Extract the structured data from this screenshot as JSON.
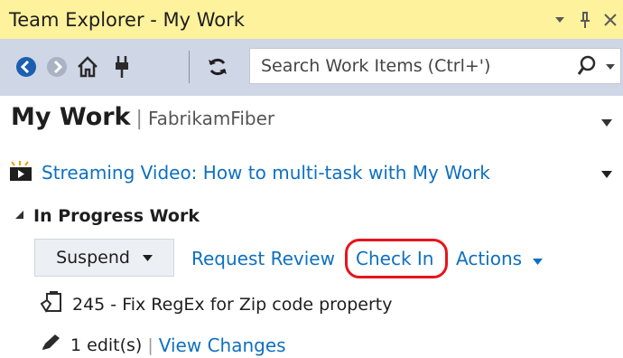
{
  "window": {
    "title": "Team Explorer - My Work"
  },
  "toolbar": {
    "search_placeholder": "Search Work Items (Ctrl+')"
  },
  "header": {
    "title": "My Work",
    "separator": "|",
    "project": "FabrikamFiber"
  },
  "video": {
    "link_label": "Streaming Video: How to multi-task with My Work"
  },
  "section": {
    "label": "In Progress Work",
    "suspend_label": "Suspend",
    "request_review_label": "Request Review",
    "check_in_label": "Check In",
    "actions_label": "Actions"
  },
  "work_item": {
    "label": "245 - Fix RegEx for Zip code property"
  },
  "changes": {
    "edits_label": "1 edit(s)",
    "separator": "|",
    "view_changes_label": "View Changes"
  },
  "colors": {
    "title_bar": "#fff29d",
    "toolbar": "#cfd6e5",
    "link": "#0e70c0",
    "highlight_ring": "#e8141b"
  },
  "icons": [
    "back-icon",
    "forward-icon",
    "home-icon",
    "connect-icon",
    "refresh-icon",
    "search-icon",
    "video-icon",
    "work-item-icon",
    "pencil-icon",
    "dropdown-icon",
    "pin-icon",
    "close-icon"
  ]
}
